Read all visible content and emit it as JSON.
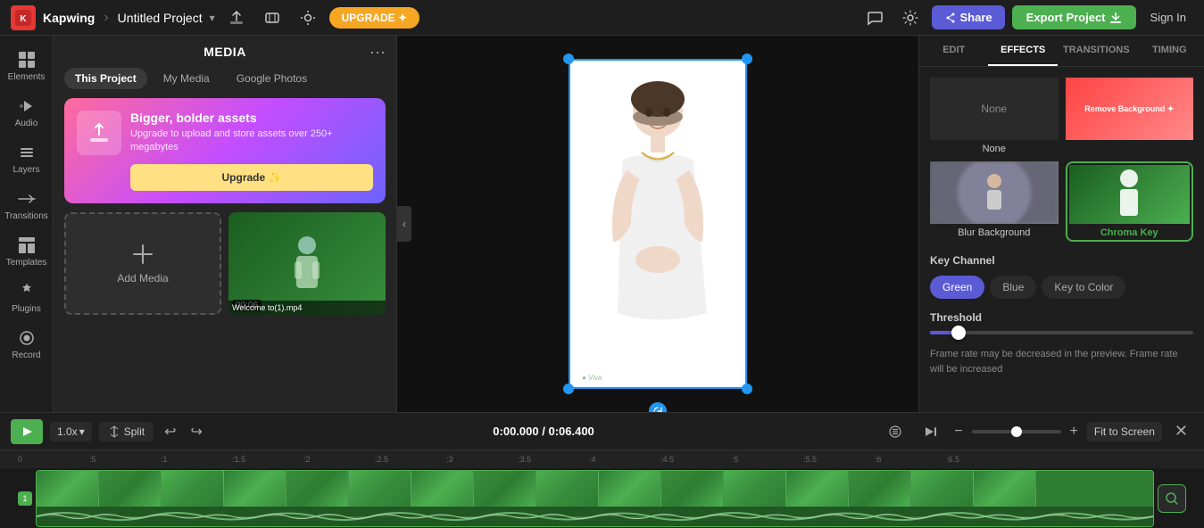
{
  "topbar": {
    "logo_text": "K",
    "brand": "Kapwing",
    "separator": "›",
    "project_title": "Untitled Project",
    "upgrade_label": "UPGRADE ✦",
    "share_label": "Share",
    "export_label": "Export Project",
    "signin_label": "Sign In"
  },
  "left_sidebar": {
    "items": [
      {
        "id": "elements",
        "label": "Elements",
        "icon": "grid"
      },
      {
        "id": "audio",
        "label": "Audio",
        "icon": "music"
      },
      {
        "id": "layers",
        "label": "Layers",
        "icon": "layers"
      },
      {
        "id": "transitions",
        "label": "Transitions",
        "icon": "transition"
      },
      {
        "id": "templates",
        "label": "Templates",
        "icon": "template"
      },
      {
        "id": "plugins",
        "label": "Plugins",
        "icon": "plugin"
      },
      {
        "id": "record",
        "label": "Record",
        "icon": "record"
      }
    ]
  },
  "media_panel": {
    "title": "MEDIA",
    "tabs": [
      {
        "id": "this-project",
        "label": "This Project",
        "active": true
      },
      {
        "id": "my-media",
        "label": "My Media",
        "active": false
      },
      {
        "id": "google-photos",
        "label": "Google Photos",
        "active": false
      }
    ],
    "upgrade_banner": {
      "title": "Bigger, bolder assets",
      "description": "Upgrade to upload and store assets over 250+ megabytes",
      "button_label": "Upgrade ✨"
    },
    "add_media_label": "Add Media",
    "media_items": [
      {
        "id": "video1",
        "filename": "Welcome to(1).mp4",
        "duration": "00:06",
        "thumbnail_color": "#1a6e2e"
      }
    ]
  },
  "right_panel": {
    "tabs": [
      {
        "id": "edit",
        "label": "EDIT"
      },
      {
        "id": "effects",
        "label": "EFFECTS",
        "active": true
      },
      {
        "id": "transitions",
        "label": "TRANSITIONS"
      },
      {
        "id": "timing",
        "label": "TIMING"
      }
    ],
    "effects": [
      {
        "id": "none",
        "label": "None",
        "selected": false
      },
      {
        "id": "remove-bg",
        "label": "Remove Background ✦",
        "selected": false
      },
      {
        "id": "blur-bg",
        "label": "Blur Background",
        "selected": false
      },
      {
        "id": "chroma-key",
        "label": "Chroma Key",
        "selected": true
      }
    ],
    "key_channel": {
      "label": "Key Channel",
      "options": [
        {
          "id": "green",
          "label": "Green",
          "active": true
        },
        {
          "id": "blue",
          "label": "Blue",
          "active": false
        },
        {
          "id": "key-to-color",
          "label": "Key to Color",
          "active": false
        }
      ]
    },
    "threshold": {
      "label": "Threshold",
      "value": 10
    },
    "fps_notice": "Frame rate may be decreased in the preview. Frame rate will be increased"
  },
  "timeline": {
    "play_label": "▶",
    "speed": "1.0x",
    "split_label": "Split",
    "time_current": "0:00.000",
    "time_total": "0:06.400",
    "fit_screen_label": "Fit to Screen",
    "ruler_marks": [
      "0",
      ":5",
      ":1",
      ":1.5",
      ":2",
      ":2.5",
      ":3",
      ":3.5",
      ":4",
      ":4.5",
      ":5",
      ":5.5",
      ":6",
      ":6.5"
    ],
    "track_id": "1",
    "video_filename": "Welcome to(1).mp4"
  }
}
